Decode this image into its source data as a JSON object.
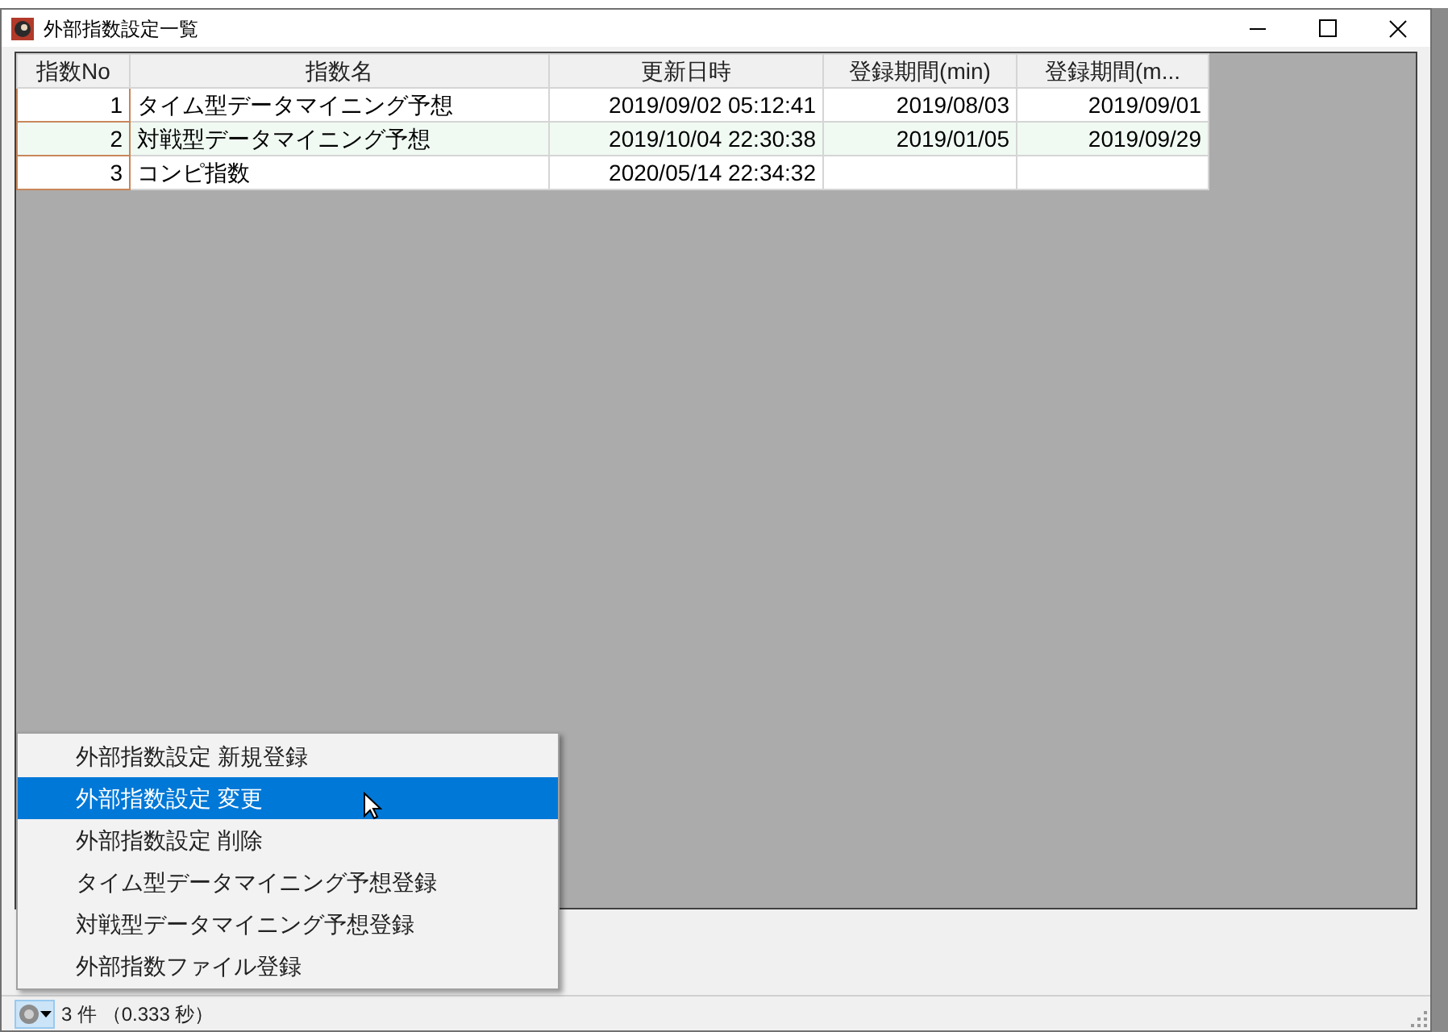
{
  "window": {
    "title": "外部指数設定一覧"
  },
  "table": {
    "columns": [
      "指数No",
      "指数名",
      "更新日時",
      "登録期間(min)",
      "登録期間(m..."
    ],
    "rows": [
      [
        "1",
        "タイム型データマイニング予想",
        "2019/09/02 05:12:41",
        "2019/08/03",
        "2019/09/01"
      ],
      [
        "2",
        "対戦型データマイニング予想",
        "2019/10/04 22:30:38",
        "2019/01/05",
        "2019/09/29"
      ],
      [
        "3",
        "コンピ指数",
        "2020/05/14 22:34:32",
        "",
        ""
      ]
    ]
  },
  "context_menu": {
    "items": [
      {
        "label": "外部指数設定 新規登録",
        "selected": false
      },
      {
        "label": "外部指数設定 変更",
        "selected": true
      },
      {
        "label": "外部指数設定 削除",
        "selected": false
      },
      {
        "label": "タイム型データマイニング予想登録",
        "selected": false
      },
      {
        "label": "対戦型データマイニング予想登録",
        "selected": false
      },
      {
        "label": "外部指数ファイル登録",
        "selected": false
      }
    ]
  },
  "status_bar": {
    "text": "3 件 （0.333 秒）"
  }
}
